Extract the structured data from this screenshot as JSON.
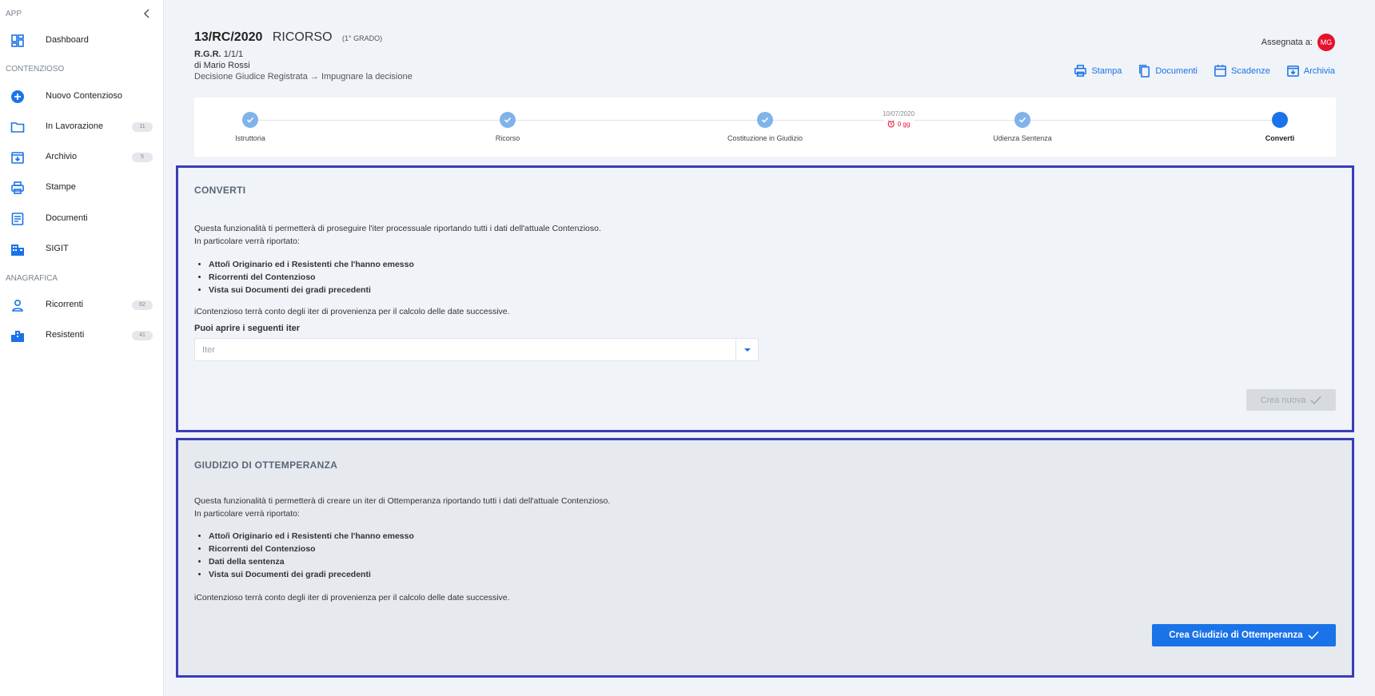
{
  "sidebar": {
    "section_app": "APP",
    "section_contenzioso": "CONTENZIOSO",
    "section_anagrafica": "ANAGRAFICA",
    "items": [
      {
        "label": "Dashboard",
        "icon": "dashboard-icon"
      },
      {
        "label": "Nuovo Contenzioso",
        "icon": "add-circle-icon"
      },
      {
        "label": "In Lavorazione",
        "icon": "folder-icon",
        "badge": "11"
      },
      {
        "label": "Archivio",
        "icon": "archive-icon",
        "badge": "5"
      },
      {
        "label": "Stampe",
        "icon": "printer-icon"
      },
      {
        "label": "Documenti",
        "icon": "document-icon"
      },
      {
        "label": "SIGIT",
        "icon": "building-icon"
      },
      {
        "label": "Ricorrenti",
        "icon": "person-icon",
        "badge": "62"
      },
      {
        "label": "Resistenti",
        "icon": "city-icon",
        "badge": "41"
      }
    ]
  },
  "header": {
    "case_number": "13/RC/2020",
    "case_type": "RICORSO",
    "grade": "(1° GRADO)",
    "rgr_label": "R.G.R.",
    "rgr_value": "1/1/1",
    "author": "di Mario Rossi",
    "decision": "Decisione Giudice Registrata → Impugnare la decisione",
    "assigned_label": "Assegnata a:",
    "assigned_initials": "MG",
    "actions": [
      "Stampa",
      "Documenti",
      "Scadenze",
      "Archivia"
    ]
  },
  "stepper": {
    "steps": [
      {
        "label": "Istruttoria",
        "status": "done"
      },
      {
        "label": "Ricorso",
        "status": "done"
      },
      {
        "label": "Costituzione in Giudizio",
        "status": "done"
      },
      {
        "label": "Udienza Sentenza",
        "status": "done"
      },
      {
        "label": "Converti",
        "status": "current"
      }
    ],
    "date": "10/07/2020",
    "due": "0 gg"
  },
  "converti": {
    "title": "CONVERTI",
    "intro_1": "Questa funzionalità ti permetterà di proseguire l'iter processuale riportando tutti i dati dell'attuale Contenzioso.",
    "intro_2": "In particolare verrà riportato:",
    "list": [
      "Atto/i Originario ed i Resistenti che l'hanno emesso",
      "Ricorrenti del Contenzioso",
      "Vista sui Documenti dei gradi precedenti"
    ],
    "note": "iContenzioso terrà conto degli iter di provenienza per il calcolo delle date successive.",
    "select_label": "Puoi aprire i seguenti iter",
    "select_placeholder": "Iter",
    "button": "Crea nuova"
  },
  "ottemperanza": {
    "title": "GIUDIZIO DI OTTEMPERANZA",
    "intro_1": "Questa funzionalità ti permetterà di creare un iter di Ottemperanza riportando tutti i dati dell'attuale Contenzioso.",
    "intro_2": "In particolare verrà riportato:",
    "list": [
      "Atto/i Originario ed i Resistenti che l'hanno emesso",
      "Ricorrenti del Contenzioso",
      "Dati della sentenza",
      "Vista sui Documenti dei gradi precedenti"
    ],
    "note": "iContenzioso terrà conto degli iter di provenienza per il calcolo delle date successive.",
    "button": "Crea Giudizio di Ottemperanza"
  },
  "colors": {
    "primary": "#1a73e8",
    "step_done": "#7fb3ea",
    "danger": "#e8102b",
    "highlight_border": "#3a3db8"
  }
}
